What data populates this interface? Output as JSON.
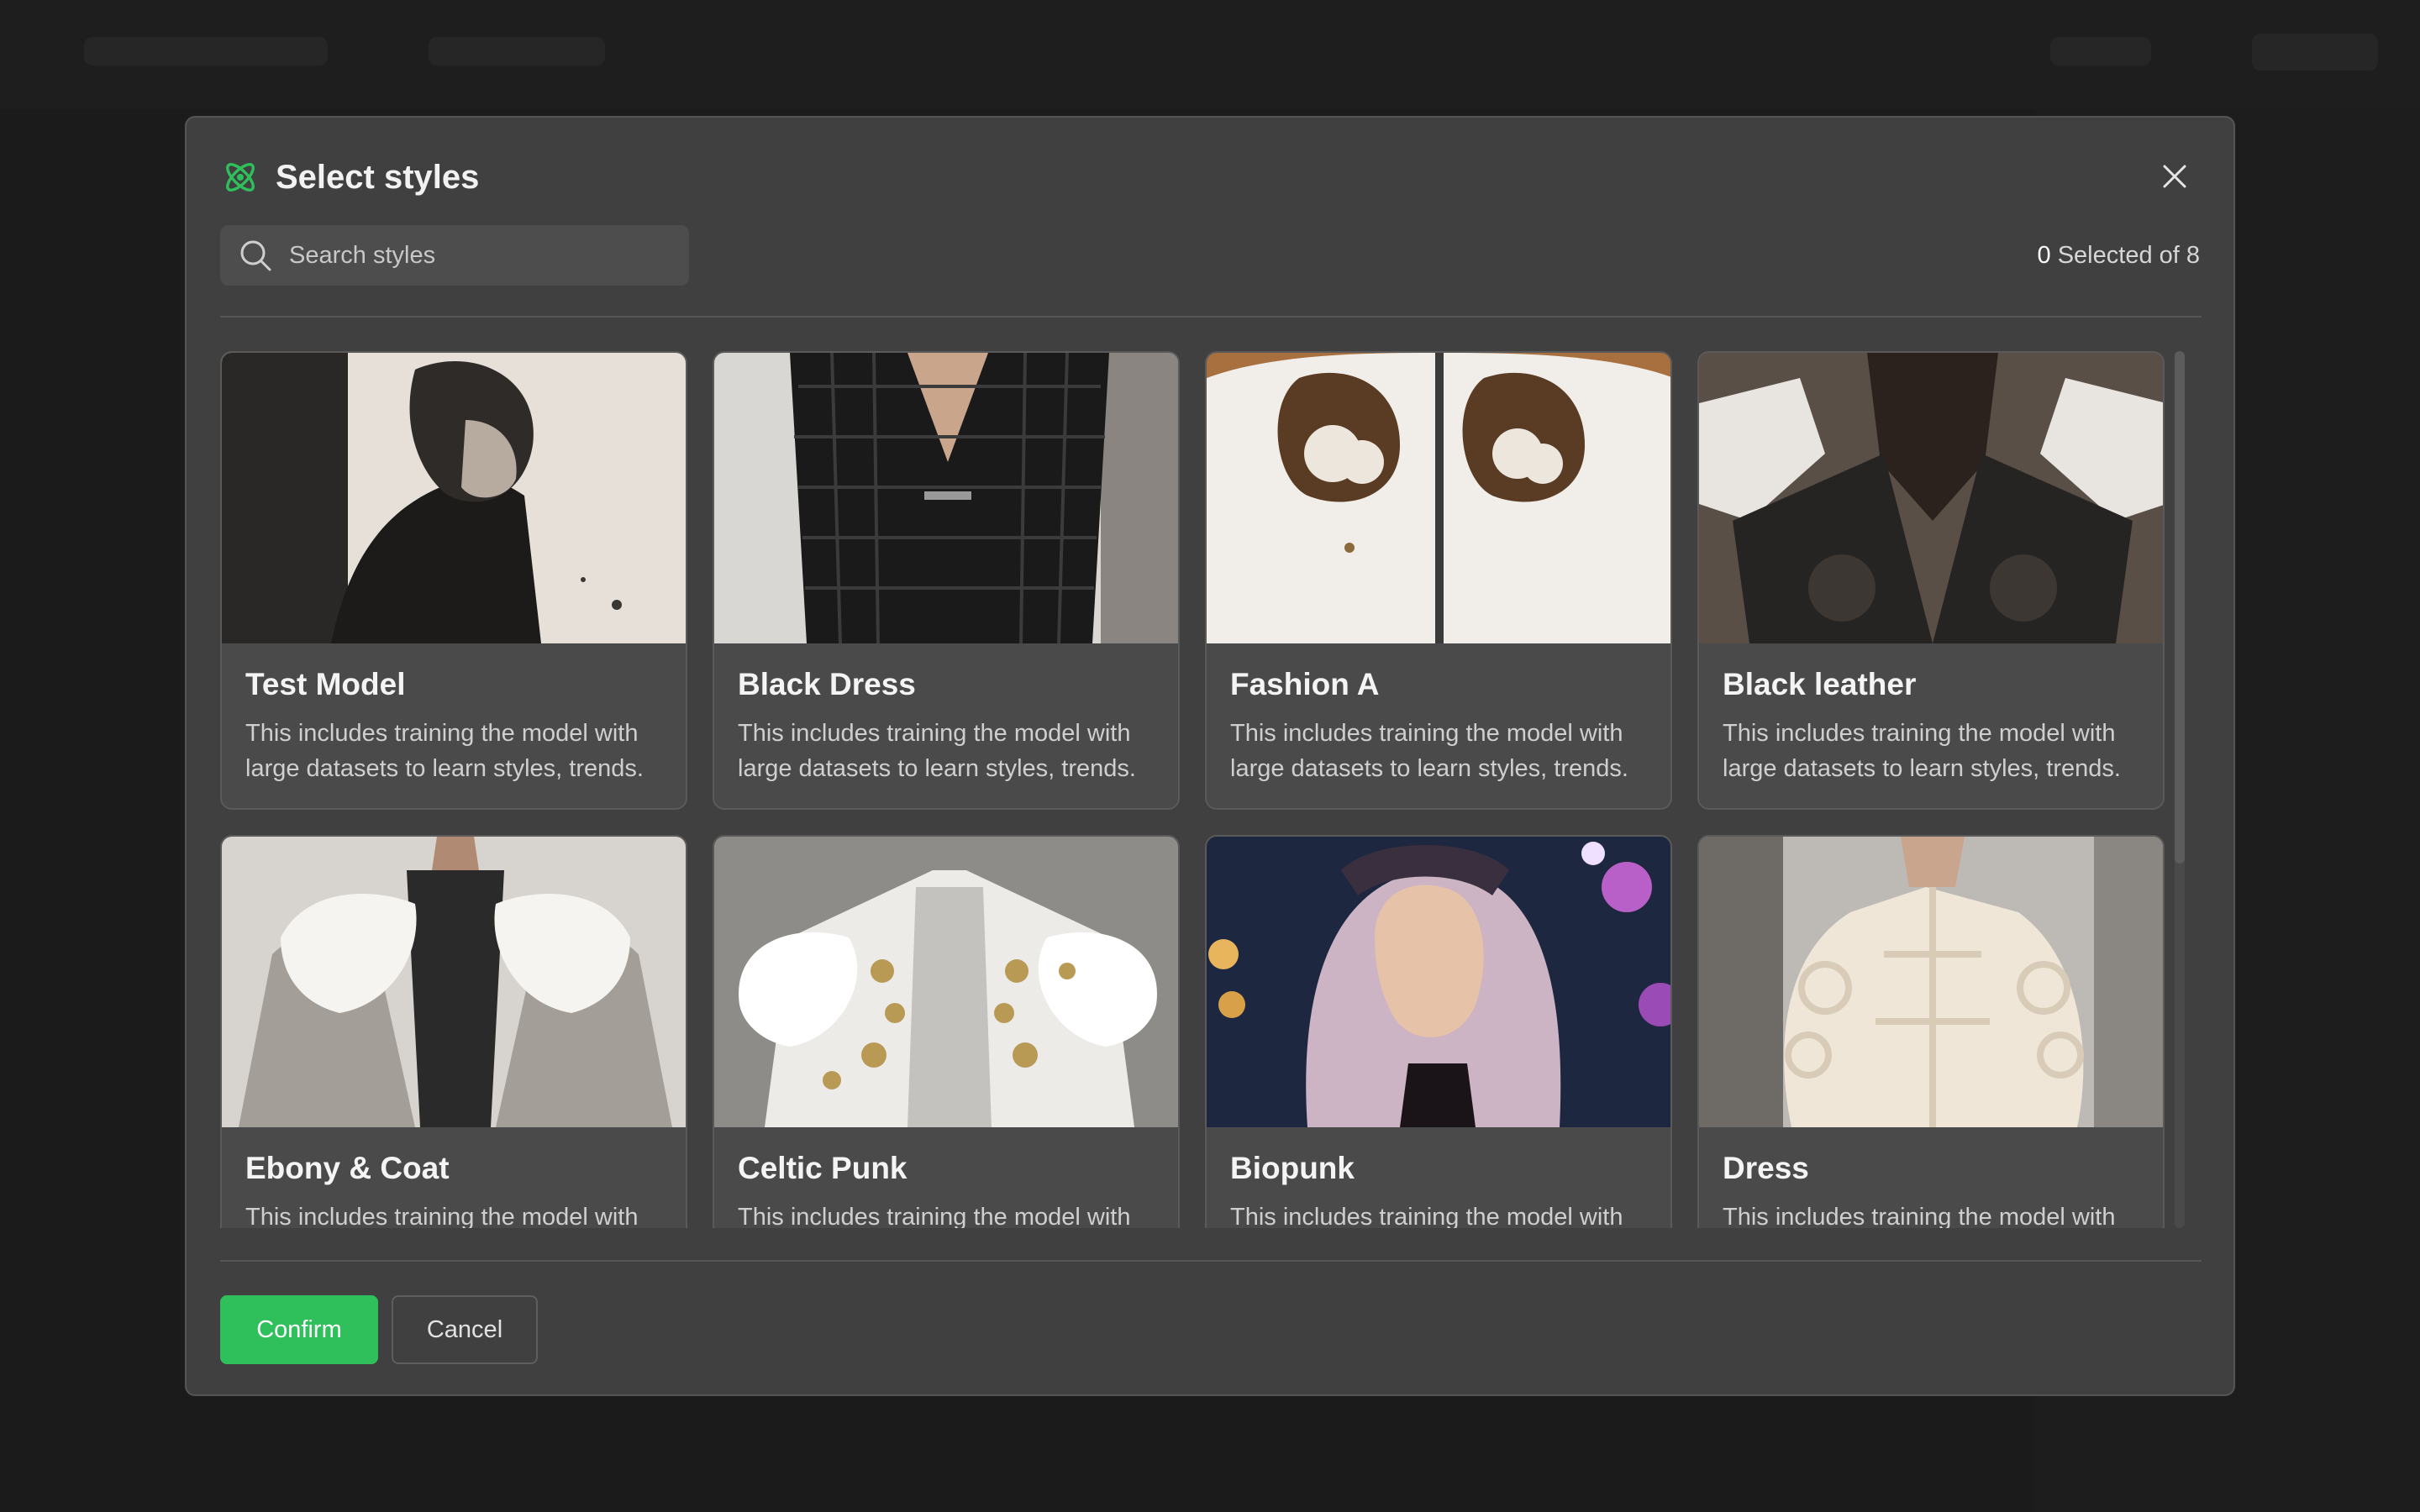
{
  "modal": {
    "title": "Select styles",
    "search": {
      "placeholder": "Search styles",
      "value": ""
    },
    "selection": {
      "count": "0",
      "suffix": " Selected of 8"
    },
    "cards": [
      {
        "title": "Test Model",
        "description": "This includes training the model with large datasets to learn styles, trends.",
        "image": "dark-haired figure in black jacket"
      },
      {
        "title": "Black Dress",
        "description": "This includes training the model with large datasets to learn styles, trends.",
        "image": "black lace dress on runway"
      },
      {
        "title": "Fashion A",
        "description": "This includes training the model with large datasets to learn styles, trends.",
        "image": "white jacket with cloud prints"
      },
      {
        "title": "Black leather",
        "description": "This includes training the model with large datasets to learn styles, trends.",
        "image": "black leather sculpted jacket"
      },
      {
        "title": "Ebony & Coat",
        "description": "This includes training the model with large datasets to learn styles, trends.",
        "image": "grey coat with white fur collar"
      },
      {
        "title": "Celtic Punk",
        "description": "This includes training the model with large datasets to learn styles, trends.",
        "image": "white and gold embroidered jacket"
      },
      {
        "title": "Biopunk",
        "description": "This includes training the model with large datasets to learn styles, trends.",
        "image": "woman with wavy hair and neon lights"
      },
      {
        "title": "Dress",
        "description": "This includes training the model with large datasets to learn styles, trends.",
        "image": "cream ruffled outfit"
      }
    ],
    "buttons": {
      "confirm": "Confirm",
      "cancel": "Cancel"
    },
    "colors": {
      "accent": "#2fbf5b",
      "modal_bg": "#404040",
      "card_bg": "#4a4a4a"
    },
    "icons": {
      "logo": "atom-icon",
      "close": "close-icon",
      "search": "search-icon"
    }
  }
}
